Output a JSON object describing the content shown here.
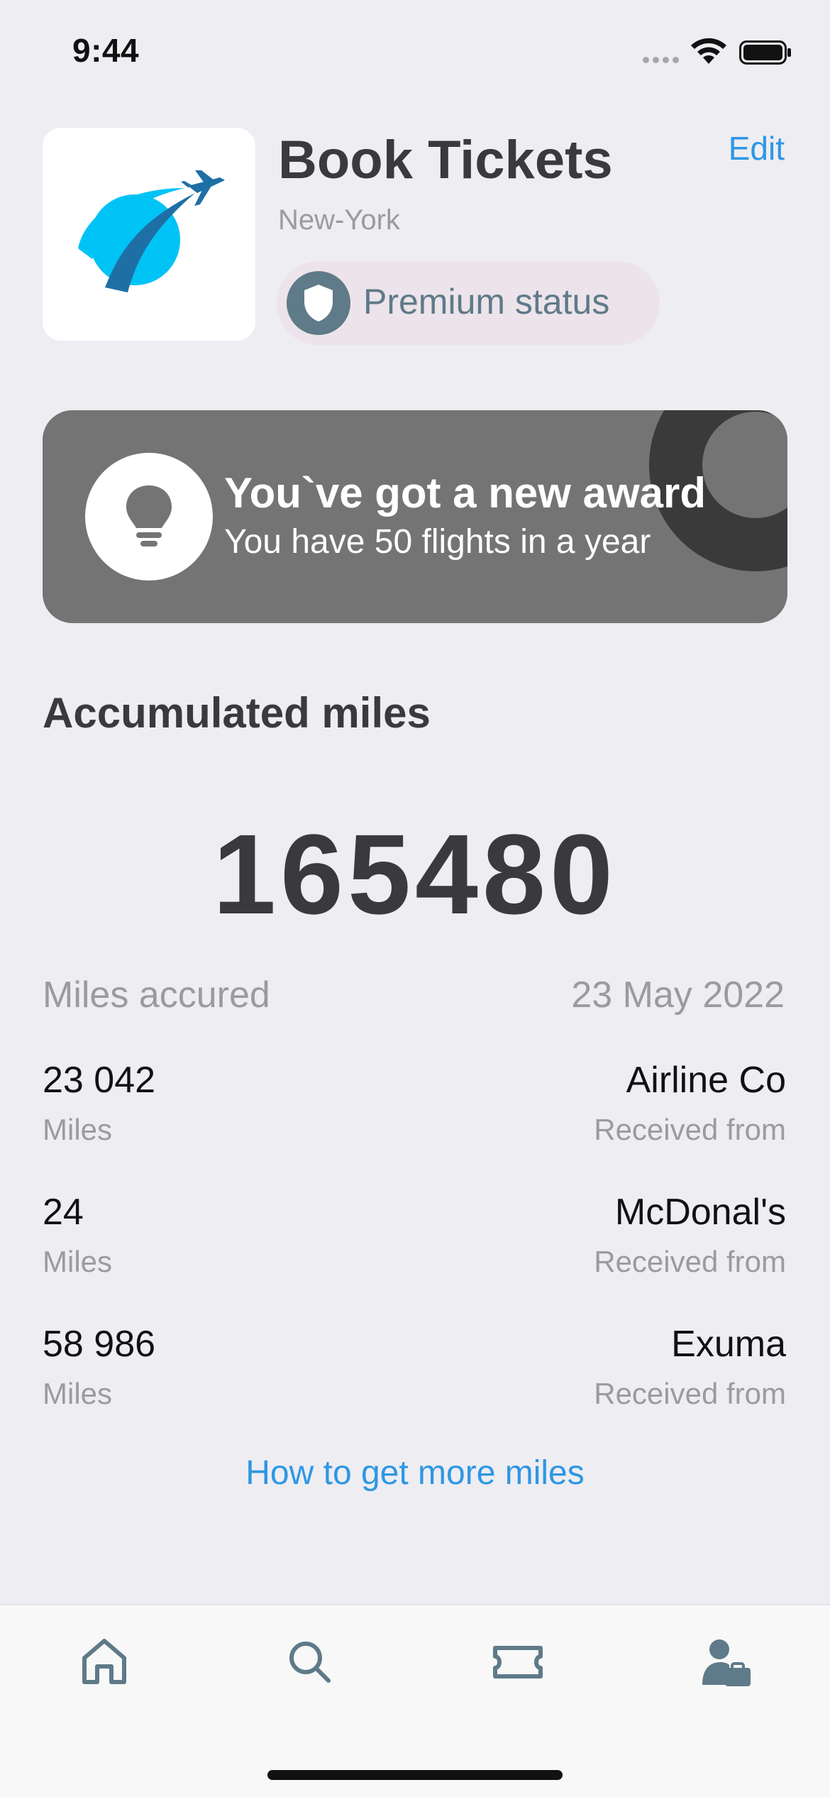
{
  "status_bar": {
    "time": "9:44",
    "icons": [
      "signal-icon",
      "wifi-icon",
      "battery-icon"
    ]
  },
  "header": {
    "logo": "airline-logo",
    "title": "Book Tickets",
    "subtitle": "New-York",
    "edit_label": "Edit",
    "status_badge": {
      "icon": "shield-icon",
      "label": "Premium status"
    }
  },
  "award": {
    "icon": "lightbulb-icon",
    "title": "You`ve got a new award",
    "text": "You have 50 flights in a year"
  },
  "miles": {
    "section_title": "Accumulated miles",
    "total": "165480",
    "header_label": "Miles accured",
    "header_date": "23 May 2022",
    "transactions": [
      {
        "amount": "23 042",
        "unit": "Miles",
        "source": "Airline Co",
        "source_label": "Received from"
      },
      {
        "amount": "24",
        "unit": "Miles",
        "source": "McDonal's",
        "source_label": "Received from"
      },
      {
        "amount": "58 986",
        "unit": "Miles",
        "source": "Exuma",
        "source_label": "Received from"
      }
    ],
    "more_link": "How to get more miles"
  },
  "tab_bar": {
    "items": [
      {
        "icon": "home-icon",
        "active": false
      },
      {
        "icon": "search-icon",
        "active": false
      },
      {
        "icon": "ticket-icon",
        "active": false
      },
      {
        "icon": "profile-icon",
        "active": true
      }
    ]
  },
  "colors": {
    "background": "#eeedf2",
    "accent": "#2e97e4",
    "award_card": "#747474",
    "premium_badge_bg": "#ece4ea",
    "premium_badge_fg": "#5f7a88",
    "icon": "#5f7a88",
    "logo_light_blue": "#00c3f5",
    "logo_dark_blue": "#1e6fa5"
  }
}
